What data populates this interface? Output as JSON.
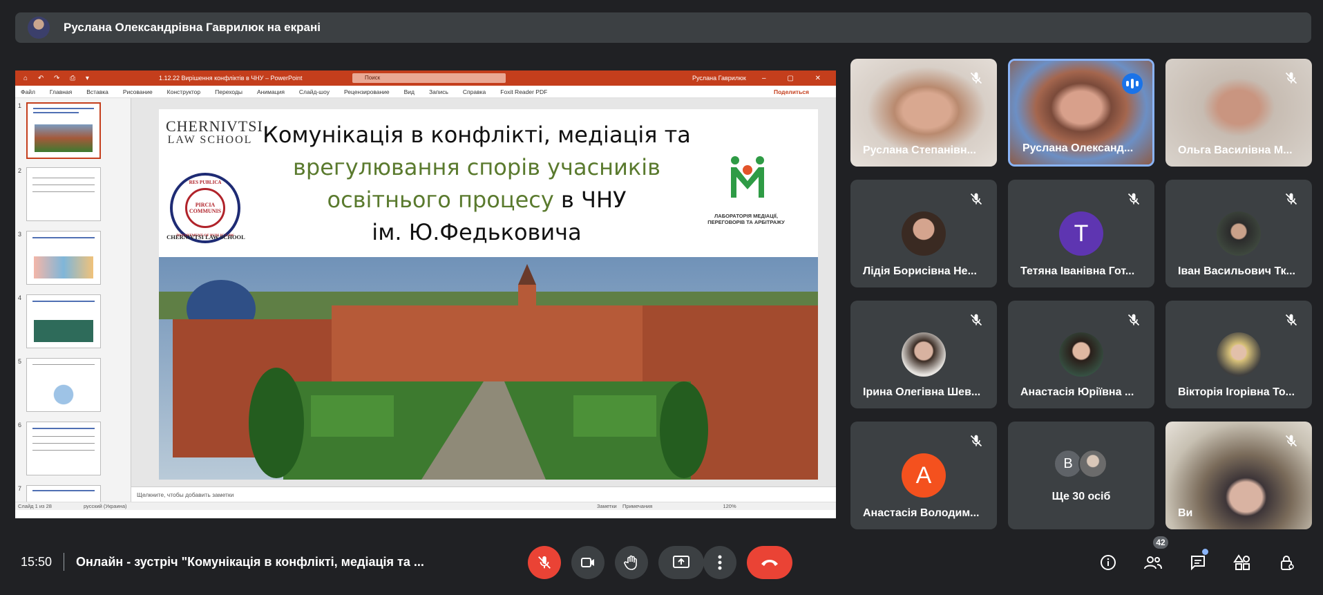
{
  "presenter": {
    "text": "Руслана Олександрівна Гаврилюк на екрані"
  },
  "powerpoint": {
    "quick_access": "⌂ ↶ ↷ ⎙ ▾",
    "doc_title": "1.12.22 Вирішення конфліктів в ЧНУ – PowerPoint",
    "search_placeholder": "Поиск",
    "user": "Руслана Гаврилюк",
    "window_controls": "– ▢ ✕",
    "menu": [
      "Файл",
      "Главная",
      "Вставка",
      "Рисование",
      "Конструктор",
      "Переходы",
      "Анимация",
      "Слайд-шоу",
      "Рецензирование",
      "Вид",
      "Запись",
      "Справка",
      "Foxit Reader PDF"
    ],
    "share": "Поделиться",
    "thumb_numbers": [
      "1",
      "2",
      "3",
      "4",
      "5",
      "6",
      "7"
    ],
    "notes_placeholder": "Щелкните, чтобы добавить заметки",
    "status": {
      "slide": "Слайд 1 из 28",
      "language": "русский (Украина)",
      "notes": "Заметки",
      "comments": "Примечания",
      "zoom": "120%"
    }
  },
  "slide": {
    "logo_line1": "CHERNIVTSI",
    "logo_line2": "LAW SCHOOL",
    "seal_top": "RES PUBLICA",
    "seal_center": "PIRCIA COMMUNIS",
    "seal_bottom": "DEPARTMENT OF PUBLIC LAW",
    "logo_bottom": "CHERNIVTSI LAW SCHOOL",
    "title_line1": "Комунікація в конфлікті, медіація та",
    "title_line2_green": "врегулювання спорів учасників",
    "title_line3_green": "освітнього процесу",
    "title_line3_black": " в ЧНУ",
    "title_line4": "ім. Ю.Федьковича",
    "lab_text": "ЛАБОРАТОРІЯ МЕДІАЦІЇ, ПЕРЕГОВОРІВ ТА АРБІТРАЖУ"
  },
  "participants": {
    "p1": "Руслана Степанівн...",
    "p2": "Руслана Олександ...",
    "p3": "Ольга Василівна М...",
    "p4": "Лідія Борисівна Не...",
    "p5": "Тетяна Іванівна Гот...",
    "p5_initial": "T",
    "p6": "Іван Васильович Тк...",
    "p7": "Ірина Олегівна Шев...",
    "p8": "Анастасія Юріївна ...",
    "p9": "Вікторія Ігорівна То...",
    "p10": "Анастасія Володим...",
    "p10_initial": "A",
    "more_initial": "B",
    "more_label": "Ще 30 осіб",
    "p12": "Ви"
  },
  "bottom": {
    "time": "15:50",
    "meeting_title": "Онлайн - зустріч \"Комунікація в конфлікті, медіація та ...",
    "people_count": "42"
  },
  "colors": {
    "accent_blue": "#8ab4f8",
    "end_call_red": "#ea4335",
    "ppt_orange": "#c43e1c"
  }
}
